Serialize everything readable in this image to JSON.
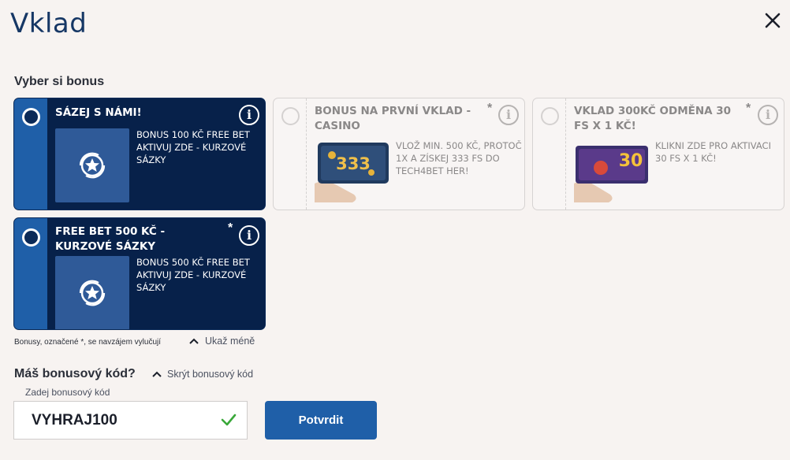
{
  "dialog": {
    "title": "Vklad",
    "close_icon": "close-icon"
  },
  "bonus_section": {
    "label": "Vyber si bonus",
    "cards": [
      {
        "title": "SÁZEJ S NÁMI!",
        "description": "BONUS 100 KČ FREE BET AKTIVUJ ZDE - KURZOVÉ SÁZKY",
        "selected": false,
        "disabled": false,
        "exclusive_mark": ""
      },
      {
        "title": "BONUS NA PRVNÍ VKLAD - CASINO",
        "description": "VLOŽ MIN. 500 KČ, PROTOČ 1X A ZÍSKEJ 333 FS DO TECH4BET HER!",
        "selected": false,
        "disabled": true,
        "exclusive_mark": "*"
      },
      {
        "title": "VKLAD 300KČ ODMĚNA 30 FS x 1 Kč!",
        "description": "KLIKNI ZDE PRO AKTIVACI 30 FS x 1 Kč!",
        "selected": false,
        "disabled": true,
        "exclusive_mark": "*"
      },
      {
        "title": "FREE BET 500 KČ - KURZOVÉ SÁZKY",
        "description": "BONUS 500 KČ FREE BET AKTIVUJ ZDE - KURZOVÉ SÁZKY",
        "selected": false,
        "disabled": false,
        "exclusive_mark": "*"
      }
    ],
    "promo_labels": {
      "casino": "333",
      "slots": "30"
    },
    "info_symbol": "i",
    "note": "Bonusy, označené *, se navzájem vylučují",
    "toggle_label": "Ukaž méně"
  },
  "bonus_code": {
    "heading": "Máš bonusový kód?",
    "toggle_label": "Skrýt bonusový kód",
    "field_label": "Zadej bonusový kód",
    "value": "VYHRAJ100",
    "valid": true,
    "confirm_label": "Potvrdit"
  },
  "colors": {
    "primary": "#1f5fa8",
    "dark_card": "#07214a",
    "title": "#163765",
    "success": "#3aa83a"
  }
}
